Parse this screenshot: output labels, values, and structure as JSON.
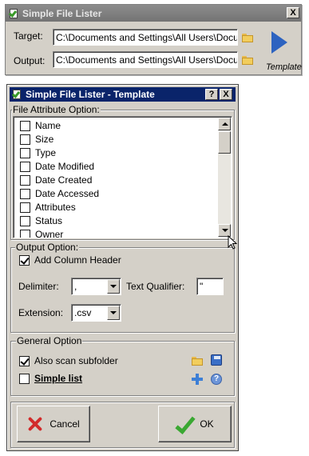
{
  "main_window": {
    "title": "Simple File Lister",
    "close_label": "X",
    "target_label": "Target:",
    "target_value": "C:\\Documents and Settings\\All Users\\Documents",
    "output_label": "Output:",
    "output_value": "C:\\Documents and Settings\\All Users\\Documents",
    "template_label": "Template"
  },
  "template_dialog": {
    "title": "Simple File Lister - Template",
    "help_label": "?",
    "close_label": "X",
    "file_attribute": {
      "group_label": "File Attribute Option:",
      "items": [
        {
          "label": "Name",
          "checked": false
        },
        {
          "label": "Size",
          "checked": false
        },
        {
          "label": "Type",
          "checked": false
        },
        {
          "label": "Date Modified",
          "checked": false
        },
        {
          "label": "Date Created",
          "checked": false
        },
        {
          "label": "Date Accessed",
          "checked": false
        },
        {
          "label": "Attributes",
          "checked": false
        },
        {
          "label": "Status",
          "checked": false
        },
        {
          "label": "Owner",
          "checked": false
        }
      ]
    },
    "output_option": {
      "group_label": "Output Option:",
      "add_column_header": "Add Column Header",
      "delimiter_label": "Delimiter:",
      "delimiter_value": ",",
      "text_qualifier_label": "Text Qualifier:",
      "text_qualifier_value": "\"",
      "extension_label": "Extension:",
      "extension_value": ".csv"
    },
    "general_option": {
      "group_label": "General Option",
      "also_scan_subfolder": "Also scan subfolder",
      "simple_list": "Simple list"
    },
    "cancel_label": "Cancel",
    "ok_label": "OK"
  },
  "colors": {
    "title_active": "#0a246a",
    "title_inactive": "#7d7d7d",
    "dialog_face": "#d4d0c8",
    "play_blue": "#2d63c0",
    "cancel_red": "#d22b2b",
    "ok_green": "#3aa832"
  }
}
